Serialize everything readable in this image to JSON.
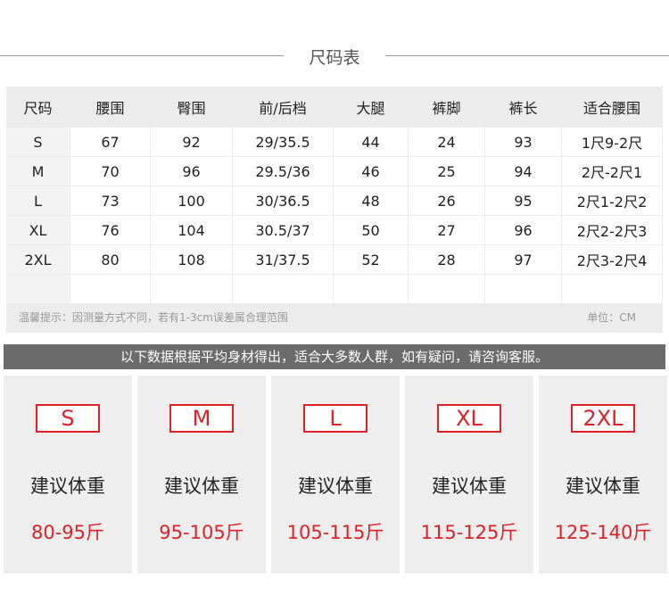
{
  "title": "尺码表",
  "table": {
    "headers": [
      "尺码",
      "腰围",
      "臀围",
      "前/后档",
      "大腿",
      "裤脚",
      "裤长",
      "适合腰围"
    ],
    "rows": [
      [
        "S",
        "67",
        "92",
        "29/35.5",
        "44",
        "24",
        "93",
        "1尺9-2尺"
      ],
      [
        "M",
        "70",
        "96",
        "29.5/36",
        "46",
        "25",
        "94",
        "2尺-2尺1"
      ],
      [
        "L",
        "73",
        "100",
        "30/36.5",
        "48",
        "26",
        "95",
        "2尺1-2尺2"
      ],
      [
        "XL",
        "76",
        "104",
        "30.5/37",
        "50",
        "27",
        "96",
        "2尺2-2尺3"
      ],
      [
        "2XL",
        "80",
        "108",
        "31/37.5",
        "52",
        "28",
        "97",
        "2尺3-2尺4"
      ]
    ]
  },
  "note": "温馨提示：因测量方式不同，若有1-3cm误差属合理范围",
  "unit": "单位：CM",
  "banner": "以下数据根据平均身材得出，适合大多数人群，如有疑问，请咨询客服。",
  "cards": [
    {
      "size": "S",
      "label": "建议体重",
      "range": "80-95斤"
    },
    {
      "size": "M",
      "label": "建议体重",
      "range": "95-105斤"
    },
    {
      "size": "L",
      "label": "建议体重",
      "range": "105-115斤"
    },
    {
      "size": "XL",
      "label": "建议体重",
      "range": "115-125斤"
    },
    {
      "size": "2XL",
      "label": "建议体重",
      "range": "125-140斤"
    }
  ],
  "colors": {
    "accent": "#e0202a",
    "banner": "#6b6b6b",
    "panel": "#eeeeee"
  }
}
